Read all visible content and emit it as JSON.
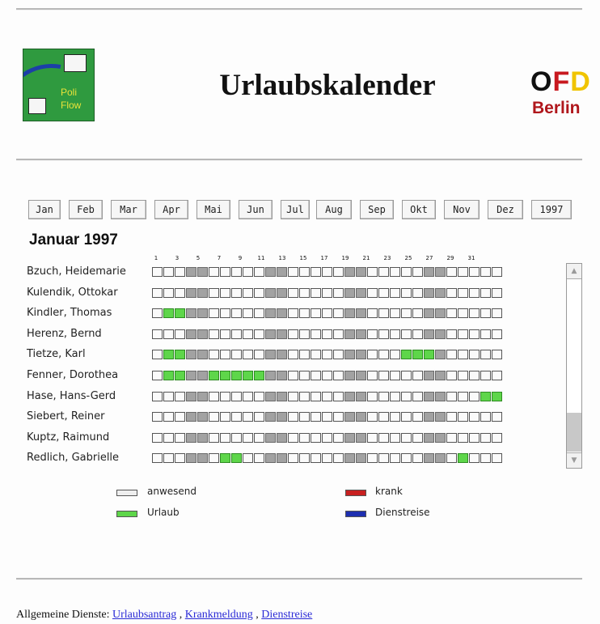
{
  "header": {
    "title": "Urlaubskalender",
    "logo_left_line1": "Poli",
    "logo_left_line2": "Flow",
    "logo_right_o": "O",
    "logo_right_f": "F",
    "logo_right_d": "D",
    "logo_right_city": "Berlin"
  },
  "months": [
    "Jan",
    "Feb",
    "Mar",
    "Apr",
    "Mai",
    "Jun",
    "Jul",
    "Aug",
    "Sep",
    "Okt",
    "Nov",
    "Dez",
    "1997"
  ],
  "calendar": {
    "title": "Januar 1997",
    "day_labels": [
      "1",
      "3",
      "5",
      "7",
      "9",
      "11",
      "13",
      "15",
      "17",
      "19",
      "21",
      "23",
      "25",
      "27",
      "29",
      "31"
    ],
    "weekend_days": [
      4,
      5,
      11,
      12,
      18,
      19,
      25,
      26
    ],
    "rows": [
      {
        "name": "Bzuch, Heidemarie",
        "vacation": []
      },
      {
        "name": "Kulendik, Ottokar",
        "vacation": []
      },
      {
        "name": "Kindler, Thomas",
        "vacation": [
          2,
          3
        ]
      },
      {
        "name": "Herenz, Bernd",
        "vacation": []
      },
      {
        "name": "Tietze, Karl",
        "vacation": [
          2,
          3,
          23,
          24,
          25
        ]
      },
      {
        "name": "Fenner, Dorothea",
        "vacation": [
          2,
          3,
          6,
          7,
          8,
          9,
          10
        ]
      },
      {
        "name": "Hase, Hans-Gerd",
        "vacation": [
          30,
          31
        ]
      },
      {
        "name": "Siebert, Reiner",
        "vacation": []
      },
      {
        "name": "Kuptz, Raimund",
        "vacation": []
      },
      {
        "name": "Redlich, Gabrielle",
        "vacation": [
          7,
          8,
          28
        ]
      }
    ]
  },
  "legend": [
    {
      "label": "anwesend",
      "color": "#eeeeee"
    },
    {
      "label": "Urlaub",
      "color": "#5ed64a"
    },
    {
      "label": "krank",
      "color": "#c82020"
    },
    {
      "label": "Dienstreise",
      "color": "#1e2fb0"
    }
  ],
  "footer": {
    "prefix": "Allgemeine Dienste:",
    "links": [
      "Urlaubsantrag",
      "Krankmeldung",
      "Dienstreise"
    ],
    "sep": ","
  }
}
